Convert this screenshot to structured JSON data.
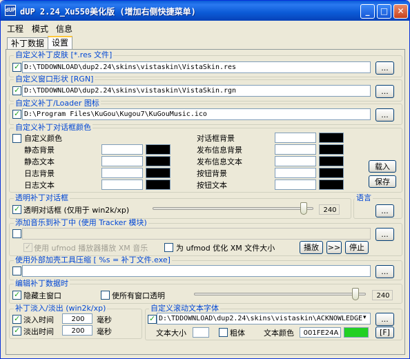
{
  "window": {
    "title": "dUP 2.24_Xu550美化版 (增加右侧快捷菜单)",
    "icon_text": "dUP"
  },
  "menu": [
    "工程",
    "模式",
    "信息"
  ],
  "tabs": [
    "补丁数据",
    "设置"
  ],
  "skin": {
    "label": "自定义补丁皮肤 [*.res 文件]",
    "path": "D:\\TDDOWNLOAD\\dup2.24\\skins\\vistaskin\\VistaSkin.res"
  },
  "shape": {
    "label": "自定义窗口形状 [RGN]",
    "path": "D:\\TDDOWNLOAD\\dup2.24\\skins\\vistaskin\\VistaSkin.rgn"
  },
  "icon": {
    "label": "自定义补丁/Loader 图标",
    "path": "D:\\Program Files\\KuGou\\Kugou7\\KuGouMusic.ico"
  },
  "browse": "...",
  "colors": {
    "label": "自定义补丁对话框颜色",
    "custom": "自定义颜色",
    "left": [
      "静态背景",
      "静态文本",
      "日志背景",
      "日志文本"
    ],
    "right": [
      "对话框背景",
      "发布信息背景",
      "发布信息文本",
      "按钮背景",
      "按钮文本"
    ],
    "load": "载入",
    "save": "保存",
    "swatch_color": "#000000"
  },
  "transparent": {
    "label": "透明补丁对话框",
    "check": "透明对话框 (仅用于 win2k/xp)",
    "value": "240",
    "level": 0.94
  },
  "language": "语言",
  "music": {
    "label": "添加音乐到补丁中 (使用 Tracker 模块)",
    "ufmod_play": "使用 ufmod 播放器播放 XM 音乐",
    "ufmod_opt": "为 ufmod 优化 XM 文件大小",
    "play": "播放",
    "next": ">>",
    "stop": "停止"
  },
  "packer": {
    "label": "使用外部加壳工具压缩 [ %s = 补丁文件.exe]"
  },
  "edit": {
    "label": "编辑补丁数据时",
    "hide": "隐藏主窗口",
    "all_trans": "使所有窗口透明",
    "value": "240",
    "level": 0.94
  },
  "fade": {
    "label": "补丁淡入/淡出 (win2k/xp)",
    "in": "淡入时间",
    "out": "淡出时间",
    "in_val": "200",
    "out_val": "200",
    "unit": "毫秒"
  },
  "scroll": {
    "label": "自定义滚动文本字体",
    "path": "D:\\TDDOWNLOAD\\dup2.24\\skins\\vistaskin\\ACKNOWLEDGE",
    "size": "文本大小",
    "bold": "粗体",
    "color_label": "文本颜色",
    "color_val": "001FE24A",
    "color": "#22d022",
    "f": "[F]"
  },
  "accent": "#0046d5"
}
